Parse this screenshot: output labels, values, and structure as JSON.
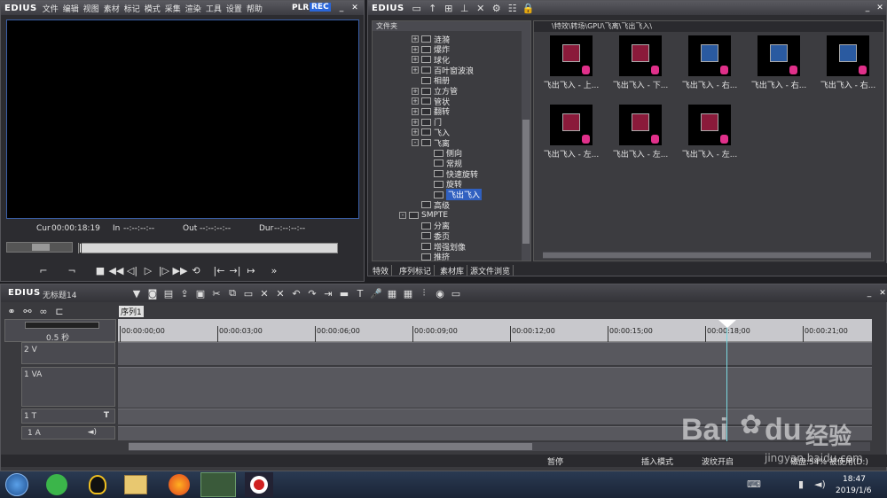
{
  "app": {
    "logo": "EDIUS",
    "menu": [
      "文件",
      "编辑",
      "视图",
      "素材",
      "标记",
      "模式",
      "采集",
      "渲染",
      "工具",
      "设置",
      "帮助"
    ],
    "plr": "PLR",
    "rec": "REC"
  },
  "player": {
    "cur_label": "Cur",
    "cur_value": "00:00:18:19",
    "in_label": "In",
    "in_value": "--:--:--:--",
    "out_label": "Out",
    "out_value": "--:--:--:--",
    "dur_label": "Dur",
    "dur_value": "--:--:--:--"
  },
  "bin": {
    "logo": "EDIUS",
    "folder_header": "文件夹",
    "path": "\\特效\\转场\\GPU\\飞离\\飞出飞入\\",
    "tree": [
      {
        "label": "涟漪",
        "level": 1,
        "exp": "+"
      },
      {
        "label": "爆炸",
        "level": 1,
        "exp": "+"
      },
      {
        "label": "球化",
        "level": 1,
        "exp": "+"
      },
      {
        "label": "百叶窗波浪",
        "level": 1,
        "exp": "+"
      },
      {
        "label": "相册",
        "level": 1,
        "exp": ""
      },
      {
        "label": "立方管",
        "level": 1,
        "exp": "+"
      },
      {
        "label": "管状",
        "level": 1,
        "exp": "+"
      },
      {
        "label": "翻转",
        "level": 1,
        "exp": "+"
      },
      {
        "label": "门",
        "level": 1,
        "exp": "+"
      },
      {
        "label": "飞入",
        "level": 1,
        "exp": "+"
      },
      {
        "label": "飞离",
        "level": 1,
        "exp": "-"
      },
      {
        "label": "侧向",
        "level": 2,
        "exp": ""
      },
      {
        "label": "常规",
        "level": 2,
        "exp": ""
      },
      {
        "label": "快速旋转",
        "level": 2,
        "exp": ""
      },
      {
        "label": "旋转",
        "level": 2,
        "exp": ""
      },
      {
        "label": "飞出飞入",
        "level": 2,
        "exp": "",
        "selected": true
      },
      {
        "label": "高级",
        "level": 1,
        "exp": ""
      },
      {
        "label": "SMPTE",
        "level": 0,
        "exp": "-"
      },
      {
        "label": "分离",
        "level": 1,
        "exp": ""
      },
      {
        "label": "委页",
        "level": 1,
        "exp": ""
      },
      {
        "label": "增强划像",
        "level": 1,
        "exp": ""
      },
      {
        "label": "推挤",
        "level": 1,
        "exp": ""
      }
    ],
    "thumbs": [
      {
        "label": "飞出飞入 - 上..."
      },
      {
        "label": "飞出飞入 - 下..."
      },
      {
        "label": "飞出飞入 - 右..."
      },
      {
        "label": "飞出飞入 - 右..."
      },
      {
        "label": "飞出飞入 - 右..."
      },
      {
        "label": "飞出飞入 - 左..."
      },
      {
        "label": "飞出飞入 - 左..."
      },
      {
        "label": "飞出飞入 - 左..."
      }
    ],
    "tabs": [
      "特效",
      "序列标记",
      "素材库",
      "源文件浏览"
    ]
  },
  "timeline": {
    "logo": "EDIUS",
    "project": "无标题14",
    "sequence_tab": "序列1",
    "zoom": "0.5 秒",
    "ruler": [
      "00:00:00;00",
      "00:00:03;00",
      "00:00:06;00",
      "00:00:09;00",
      "00:00:12;00",
      "00:00:15;00",
      "00:00:18;00",
      "00:00:21;00"
    ],
    "tracks": [
      {
        "name": "2 V"
      },
      {
        "name": "1 VA"
      },
      {
        "name": "1 T"
      },
      {
        "name": "1 A"
      }
    ],
    "status": {
      "pause": "暂停",
      "insert_mode": "插入模式",
      "ripple": "波纹开启",
      "disk": "磁盘:54% 被使用(D:)"
    }
  },
  "watermark": {
    "text": "Bai",
    "text2": "du",
    "cn": "经验",
    "url": "jingyan.baidu.com"
  },
  "taskbar": {
    "time": "18:47",
    "date": "2019/1/6"
  },
  "colors": {
    "accent_blue": "#3a5fa8",
    "rec_blue": "#2a66d9",
    "playhead": "#7ad9e0"
  }
}
